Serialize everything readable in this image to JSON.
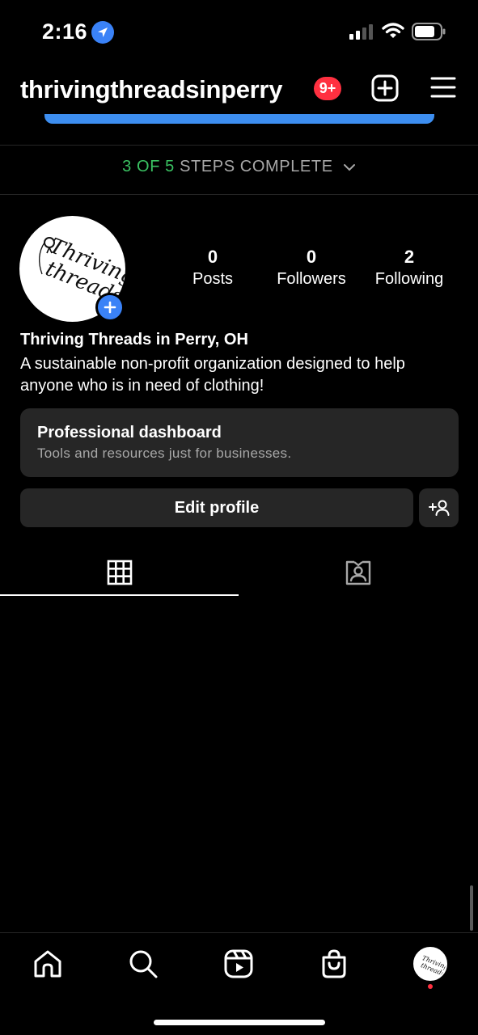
{
  "status_bar": {
    "time": "2:16",
    "icons": [
      "location-arrow-icon",
      "cellular-signal-icon",
      "wifi-icon",
      "battery-icon"
    ]
  },
  "header": {
    "username": "thrivingthreadsinperry",
    "notification_badge": "9+",
    "icons": [
      "create-post-icon",
      "menu-icon"
    ]
  },
  "setup": {
    "steps_done": "3 OF 5",
    "steps_rest": "STEPS COMPLETE",
    "icon": "chevron-down-icon"
  },
  "profile": {
    "avatar_logo_text": "Thriving threads",
    "stats": [
      {
        "value": "0",
        "label": "Posts"
      },
      {
        "value": "0",
        "label": "Followers"
      },
      {
        "value": "2",
        "label": "Following"
      }
    ],
    "name": "Thriving Threads in Perry, OH",
    "bio": "A sustainable non-profit organization designed to help anyone who is in need of clothing!"
  },
  "dashboard": {
    "title": "Professional dashboard",
    "subtitle": "Tools and resources just for businesses."
  },
  "actions": {
    "edit_profile": "Edit profile"
  },
  "tabs": [
    {
      "icon": "grid-icon",
      "active": true
    },
    {
      "icon": "tagged-icon",
      "active": false
    }
  ],
  "bottom_nav": {
    "items": [
      "home-icon",
      "search-icon",
      "reels-icon",
      "shop-icon",
      "profile-avatar"
    ]
  },
  "colors": {
    "accent_blue": "#3a82f7",
    "progress_green": "#3ac262",
    "badge_red": "#ff3040",
    "surface": "#262626",
    "background": "#000000"
  }
}
